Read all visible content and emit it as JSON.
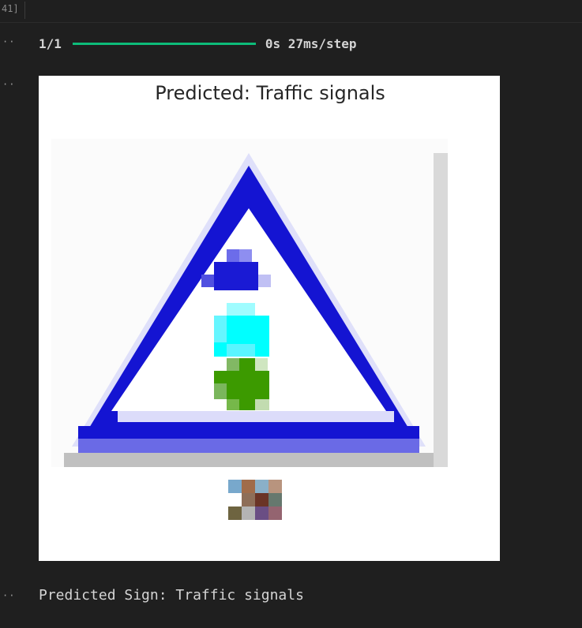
{
  "cell": {
    "execution_count": "41]"
  },
  "progress": {
    "step_text": "1/1",
    "fraction": 1.0,
    "time_text": "0s 27ms/step",
    "bar_color": "#0dbc79"
  },
  "figure": {
    "title": "Predicted: Traffic signals"
  },
  "result": {
    "text": "Predicted Sign: Traffic signals"
  },
  "colors": {
    "sign_blue": "#1414d2",
    "signal_cyan": "#00ffff",
    "signal_green": "#3c9a00"
  }
}
